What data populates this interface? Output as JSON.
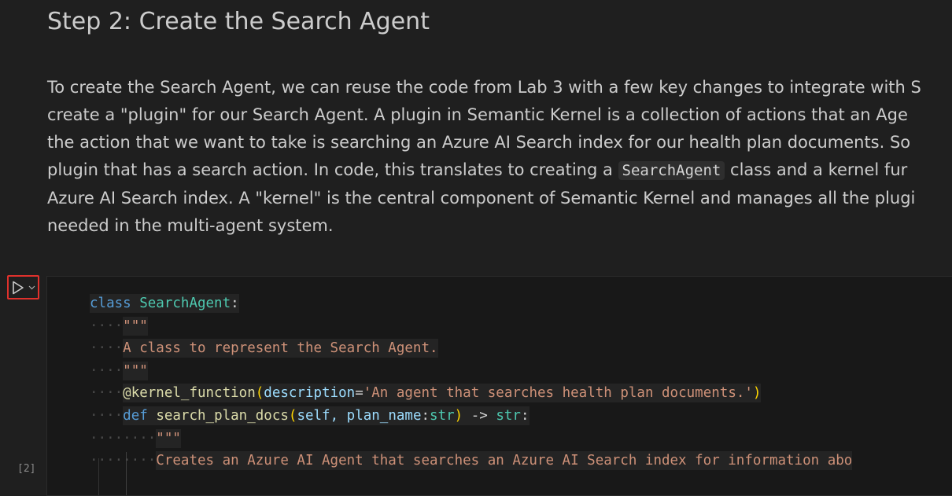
{
  "markdown": {
    "title": "Step 2: Create the Search Agent",
    "para_lines": [
      "To create the Search Agent, we can reuse the code from Lab 3 with a few key changes to integrate with S",
      "create a \"plugin\" for our Search Agent. A plugin in Semantic Kernel is a collection of actions that an Age",
      "the action that we want to take is searching an Azure AI Search index for our health plan documents. So",
      "plugin that has a search action. In code, this translates to creating a ",
      "SearchAgent",
      " class and a kernel fur",
      "Azure AI Search index. A \"kernel\" is the central component of Semantic Kernel and manages all the plugi",
      "needed in the multi-agent system."
    ]
  },
  "cell": {
    "execution_count": "[2]",
    "code": {
      "l1_kw": "class",
      "l1_cls": "SearchAgent",
      "l1_colon": ":",
      "l2_str": "\"\"\"",
      "l3_str": "A class to represent the Search Agent.",
      "l4_str": "\"\"\"",
      "l5_deco": "@kernel_function",
      "l5_param": "description",
      "l5_eq": "=",
      "l5_str": "'An agent that searches health plan documents.'",
      "l6_kw": "def",
      "l6_fn": "search_plan_docs",
      "l6_self": "self, ",
      "l6_param": "plan_name",
      "l6_colon": ":",
      "l6_type1": "str",
      "l6_arrow": " -> ",
      "l6_type2": "str",
      "l6_end": ":",
      "l7_str": "\"\"\"",
      "l8_str": "Creates an Azure AI Agent that searches an Azure AI Search index for information abo"
    }
  },
  "colors": {
    "background": "#1f1f1f",
    "run_button_highlight": "#e0312c"
  }
}
